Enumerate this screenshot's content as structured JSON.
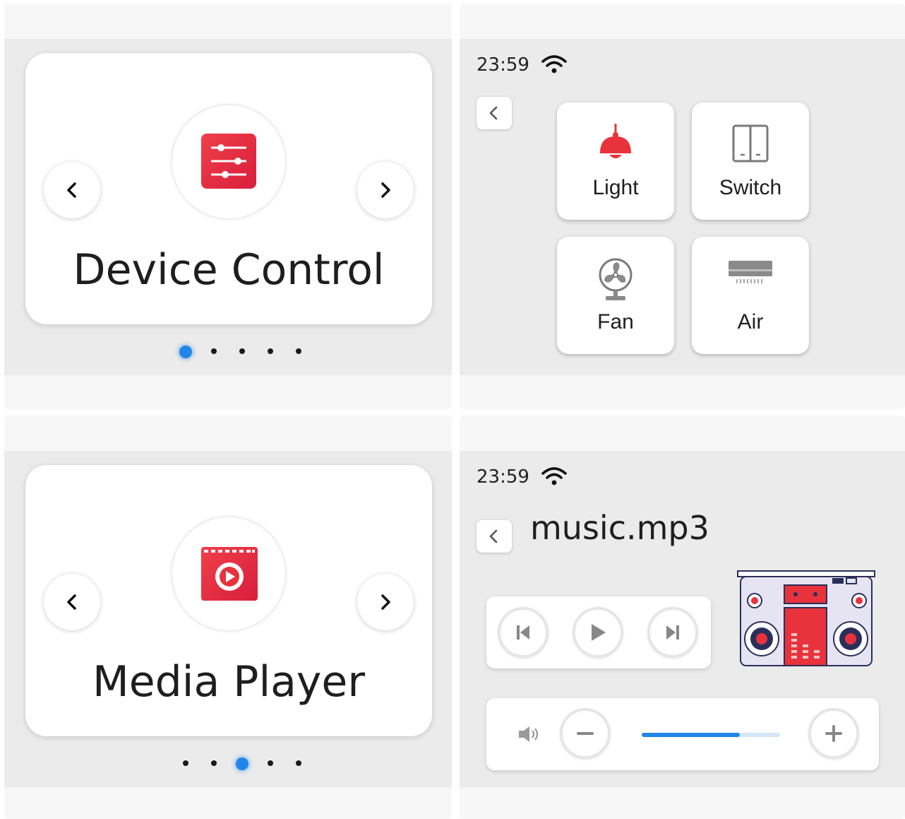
{
  "panels": {
    "device_carousel": {
      "title": "Device Control",
      "icon": "sliders-icon",
      "active_dot": 0,
      "dot_count": 5
    },
    "device_screen": {
      "status": {
        "time": "23:59",
        "wifi_icon": "wifi-icon"
      },
      "tiles": [
        {
          "label": "Light",
          "icon": "ceiling-lamp-icon"
        },
        {
          "label": "Switch",
          "icon": "wall-switch-icon"
        },
        {
          "label": "Fan",
          "icon": "fan-icon"
        },
        {
          "label": "Air",
          "icon": "air-conditioner-icon"
        }
      ]
    },
    "media_carousel": {
      "title": "Media Player",
      "icon": "video-play-icon",
      "active_dot": 2,
      "dot_count": 5
    },
    "media_screen": {
      "status": {
        "time": "23:59",
        "wifi_icon": "wifi-icon"
      },
      "track": "music.mp3",
      "artwork_icon": "boombox-icon",
      "volume_level": 0.71
    }
  },
  "colors": {
    "accent_red": "#e8333c",
    "accent_blue": "#2186e8",
    "screen_bg": "#ebebeb"
  }
}
